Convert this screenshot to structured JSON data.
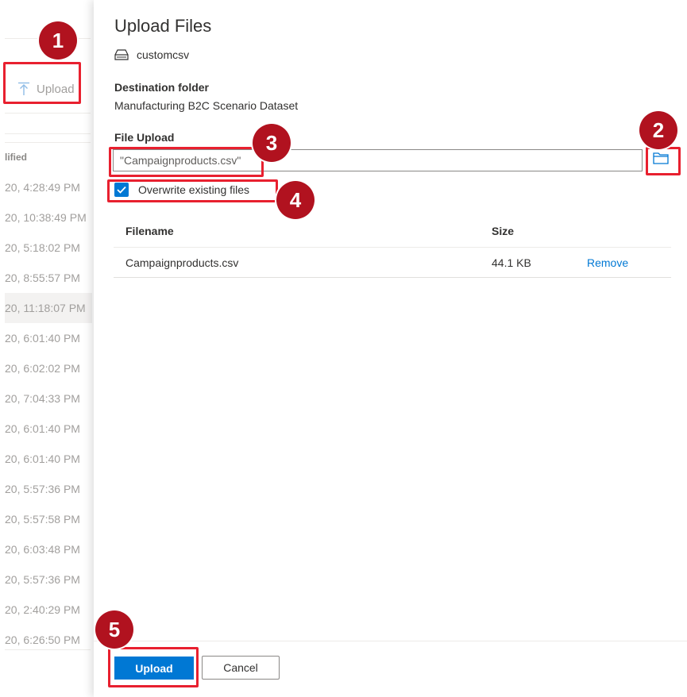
{
  "background": {
    "upload_label": "Upload",
    "column_header": "lified",
    "rows": [
      "20, 4:28:49 PM",
      "20, 10:38:49 PM",
      "20, 5:18:02 PM",
      "20, 8:55:57 PM",
      "20, 11:18:07 PM",
      "20, 6:01:40 PM",
      "20, 6:02:02 PM",
      "20, 7:04:33 PM",
      "20, 6:01:40 PM",
      "20, 6:01:40 PM",
      "20, 5:57:36 PM",
      "20, 5:57:58 PM",
      "20, 6:03:48 PM",
      "20, 5:57:36 PM",
      "20, 2:40:29 PM",
      "20, 6:26:50 PM"
    ],
    "highlighted_row_index": 4
  },
  "panel": {
    "title": "Upload Files",
    "container_name": "customcsv",
    "destination_label": "Destination folder",
    "destination_value": "Manufacturing B2C Scenario Dataset",
    "file_upload_label": "File Upload",
    "file_input_value": "\"Campaignproducts.csv\"",
    "overwrite_label": "Overwrite existing files",
    "overwrite_checked": true,
    "table": {
      "headers": {
        "filename": "Filename",
        "size": "Size"
      },
      "rows": [
        {
          "filename": "Campaignproducts.csv",
          "size": "44.1 KB",
          "action": "Remove"
        }
      ]
    },
    "upload_button": "Upload",
    "cancel_button": "Cancel"
  },
  "annotations": {
    "badges": [
      "1",
      "2",
      "3",
      "4",
      "5"
    ],
    "color": "#e8202f"
  },
  "colors": {
    "accent": "#0078d4",
    "annotation_badge": "#b1121f"
  }
}
